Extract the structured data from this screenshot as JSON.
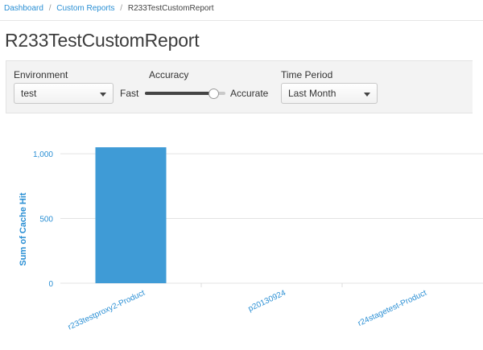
{
  "breadcrumb": {
    "items": [
      {
        "label": "Dashboard"
      },
      {
        "label": "Custom Reports"
      },
      {
        "label": "R233TestCustomReport"
      }
    ],
    "separator": "/"
  },
  "page": {
    "title": "R233TestCustomReport"
  },
  "controls": {
    "environment": {
      "label": "Environment",
      "value": "test"
    },
    "accuracy": {
      "label": "Accuracy",
      "min_label": "Fast",
      "max_label": "Accurate",
      "level": 0.85
    },
    "time_period": {
      "label": "Time Period",
      "value": "Last Month"
    }
  },
  "colors": {
    "accent": "#2a8fd4",
    "bar": "#3f9bd6"
  },
  "chart_data": {
    "type": "bar",
    "categories": [
      "r233testproxy2-Product",
      "p20130924",
      "r24stagetest-Product"
    ],
    "values": [
      1050,
      0,
      0
    ],
    "ylabel": "Sum of Cache Hit",
    "xlabel": "",
    "ylim": [
      0,
      1100
    ],
    "yticks": [
      0,
      500,
      1000
    ],
    "ytick_labels": [
      "0",
      "500",
      "1,000"
    ],
    "grid": true
  }
}
